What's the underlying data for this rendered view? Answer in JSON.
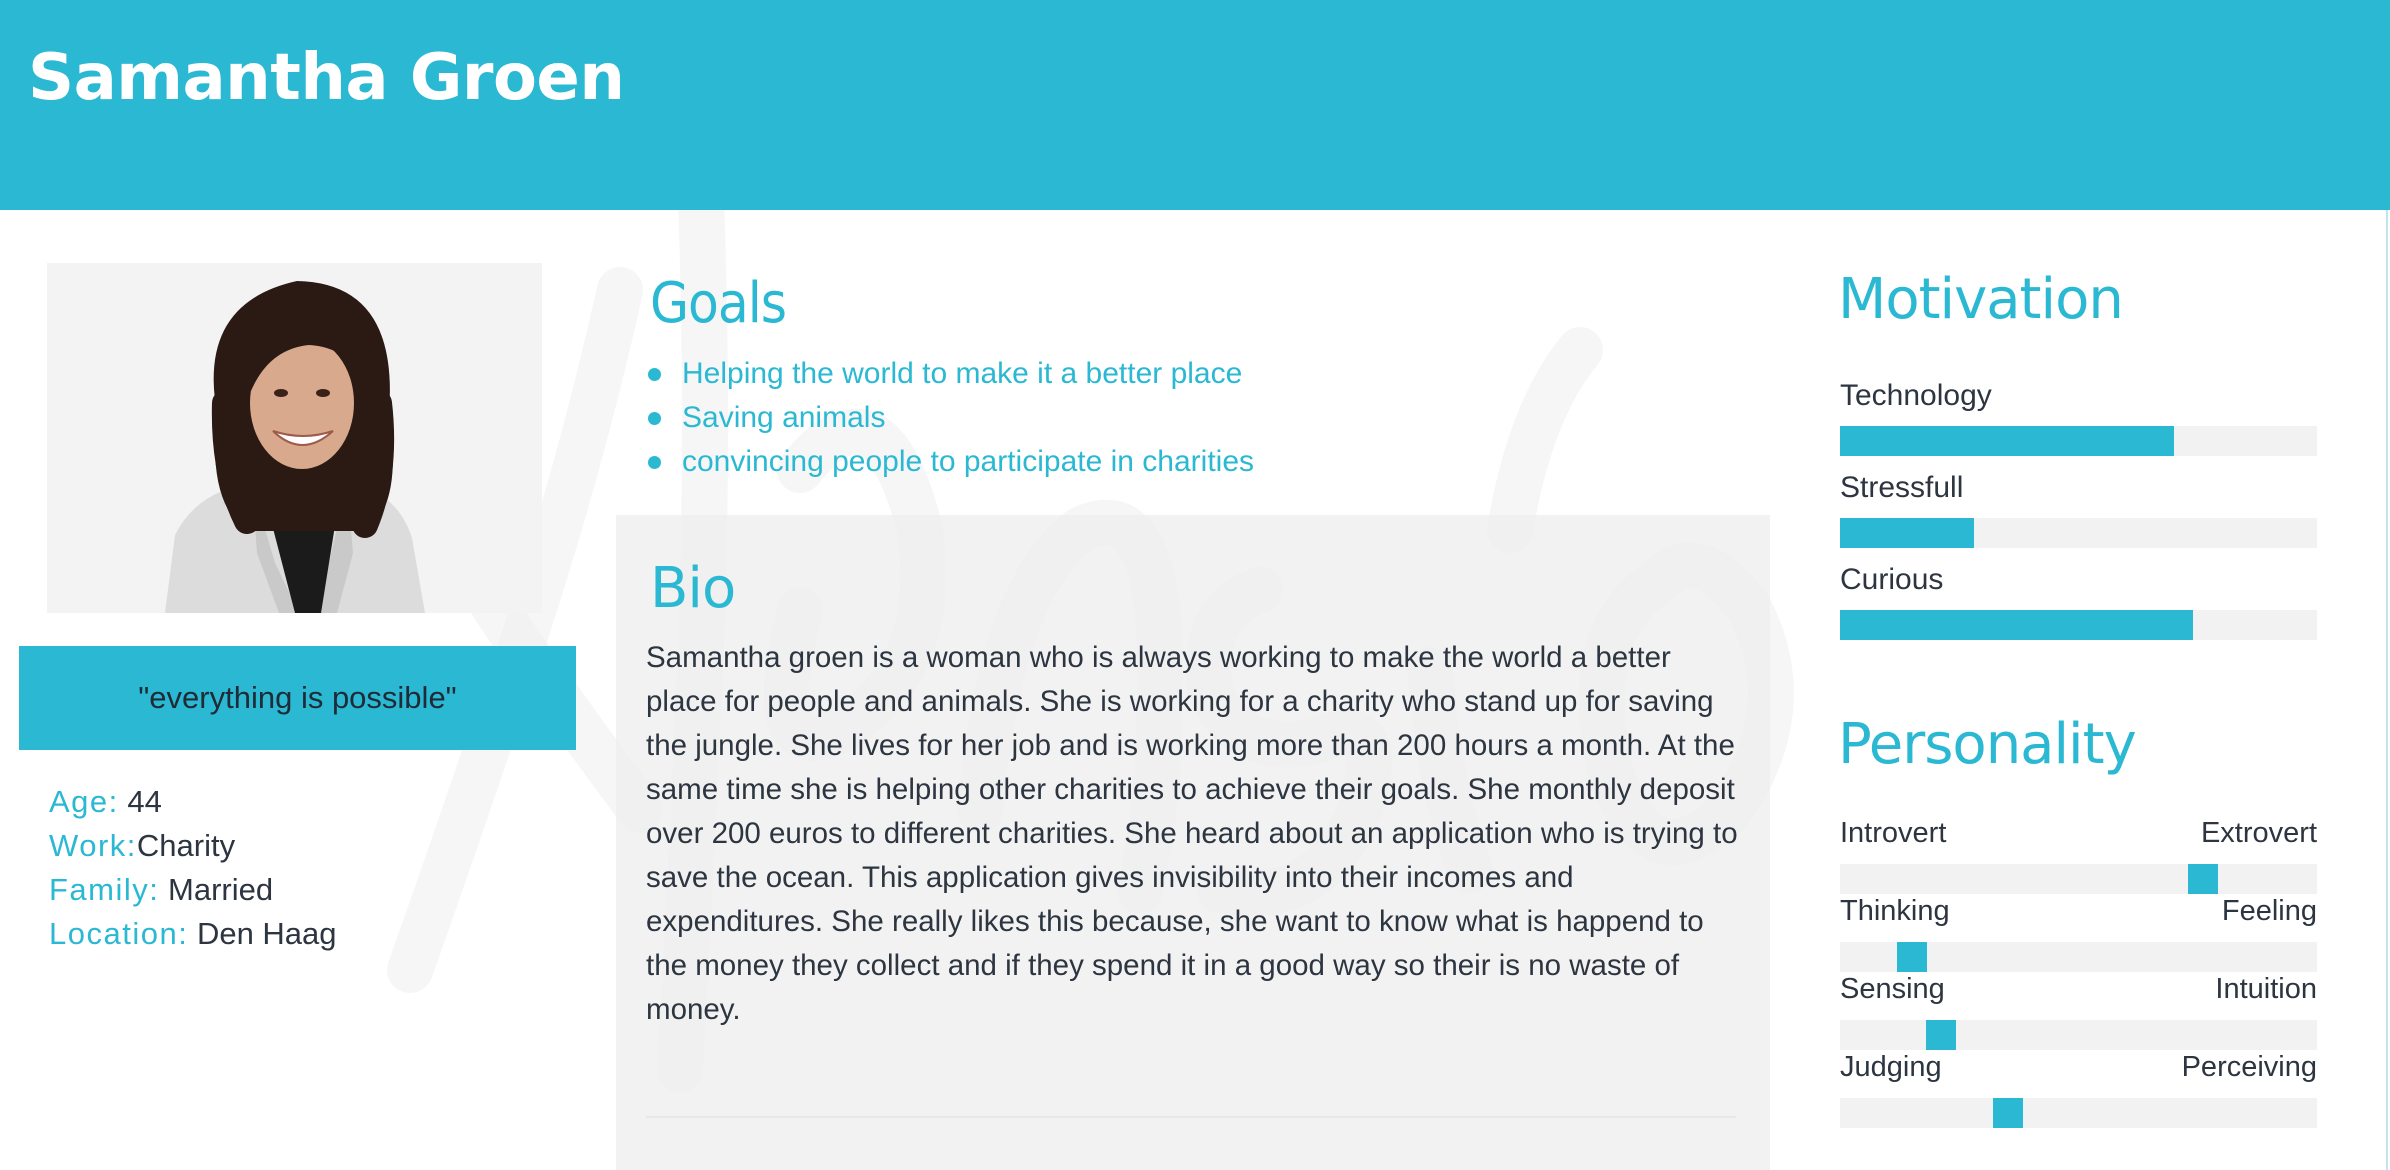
{
  "header": {
    "name": "Samantha Groen"
  },
  "profile": {
    "quote": "\"everything is possible\"",
    "facts": [
      {
        "key": "Age:",
        "value": " 44"
      },
      {
        "key": "Work:",
        "value": "Charity"
      },
      {
        "key": "Family:",
        "value": " Married"
      },
      {
        "key": "Location:",
        "value": " Den Haag"
      }
    ]
  },
  "goals": {
    "title": "Goals",
    "items": [
      "Helping the world to make it a better place",
      "Saving animals",
      "convincing people to participate in charities"
    ]
  },
  "bio": {
    "title": "Bio",
    "text": "Samantha groen is a woman who is always working to make the world a better place for people and animals. She is working for a charity who stand up for saving the jungle. She lives for her job and is working more than 200 hours a month. At the same time she is helping other charities to achieve their goals. She monthly deposit over 200 euros to different charities. She heard about an application who is trying to save the ocean. This application gives invisibility into their incomes and expenditures. She really likes this because,  she want to know what is happend to the money they collect and  if they spend it in a good way so their is no waste of money."
  },
  "motivation": {
    "title": "Motivation",
    "items": [
      {
        "label": "Technology",
        "level": 0.7
      },
      {
        "label": "Stressfull",
        "level": 0.28
      },
      {
        "label": "Curious",
        "level": 0.74
      }
    ]
  },
  "personality": {
    "title": "Personality",
    "items": [
      {
        "left": "Introvert",
        "right": "Extrovert",
        "position": 0.73
      },
      {
        "left": "Thinking",
        "right": "Feeling",
        "position": 0.12
      },
      {
        "left": "Sensing",
        "right": "Intuition",
        "position": 0.18
      },
      {
        "left": "Judging",
        "right": "Perceiving",
        "position": 0.32
      }
    ]
  },
  "colors": {
    "accent": "#2bb8d3",
    "text": "#2c3540",
    "track": "#f2f2f2",
    "panel": "#eeeeee"
  }
}
